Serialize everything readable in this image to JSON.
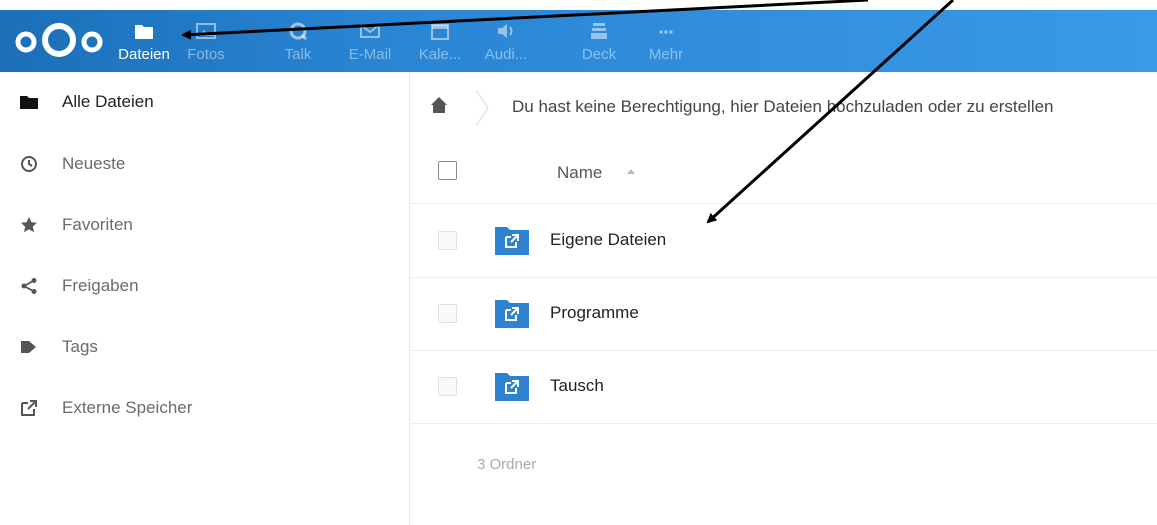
{
  "header": {
    "apps": [
      {
        "label": "Dateien",
        "icon": "folder-icon",
        "active": true
      },
      {
        "label": "Fotos",
        "icon": "image-icon",
        "active": false
      },
      {
        "label": "Talk",
        "icon": "talk-icon",
        "active": false
      },
      {
        "label": "E-Mail",
        "icon": "mail-icon",
        "active": false
      },
      {
        "label": "Kale...",
        "icon": "calendar-icon",
        "active": false
      },
      {
        "label": "Audi...",
        "icon": "audio-icon",
        "active": false
      },
      {
        "label": "Deck",
        "icon": "deck-icon",
        "active": false
      },
      {
        "label": "Mehr",
        "icon": "more-icon",
        "active": false
      }
    ]
  },
  "sidebar": {
    "items": [
      {
        "label": "Alle Dateien",
        "icon": "folder-icon",
        "active": true
      },
      {
        "label": "Neueste",
        "icon": "clock-icon",
        "active": false
      },
      {
        "label": "Favoriten",
        "icon": "star-icon",
        "active": false
      },
      {
        "label": "Freigaben",
        "icon": "share-icon",
        "active": false
      },
      {
        "label": "Tags",
        "icon": "tag-icon",
        "active": false
      },
      {
        "label": "Externe Speicher",
        "icon": "external-icon",
        "active": false
      }
    ]
  },
  "main": {
    "notice": "Du hast keine Berechtigung, hier Dateien hochzuladen oder zu erstellen",
    "column_name": "Name",
    "files": [
      {
        "name": "Eigene Dateien",
        "icon": "external-folder-icon"
      },
      {
        "name": "Programme",
        "icon": "external-folder-icon"
      },
      {
        "name": "Tausch",
        "icon": "external-folder-icon"
      }
    ],
    "summary": "3 Ordner"
  },
  "colors": {
    "header_start": "#1c6fb8",
    "header_end": "#3a9ae6",
    "folder_blue": "#2d83d2"
  }
}
